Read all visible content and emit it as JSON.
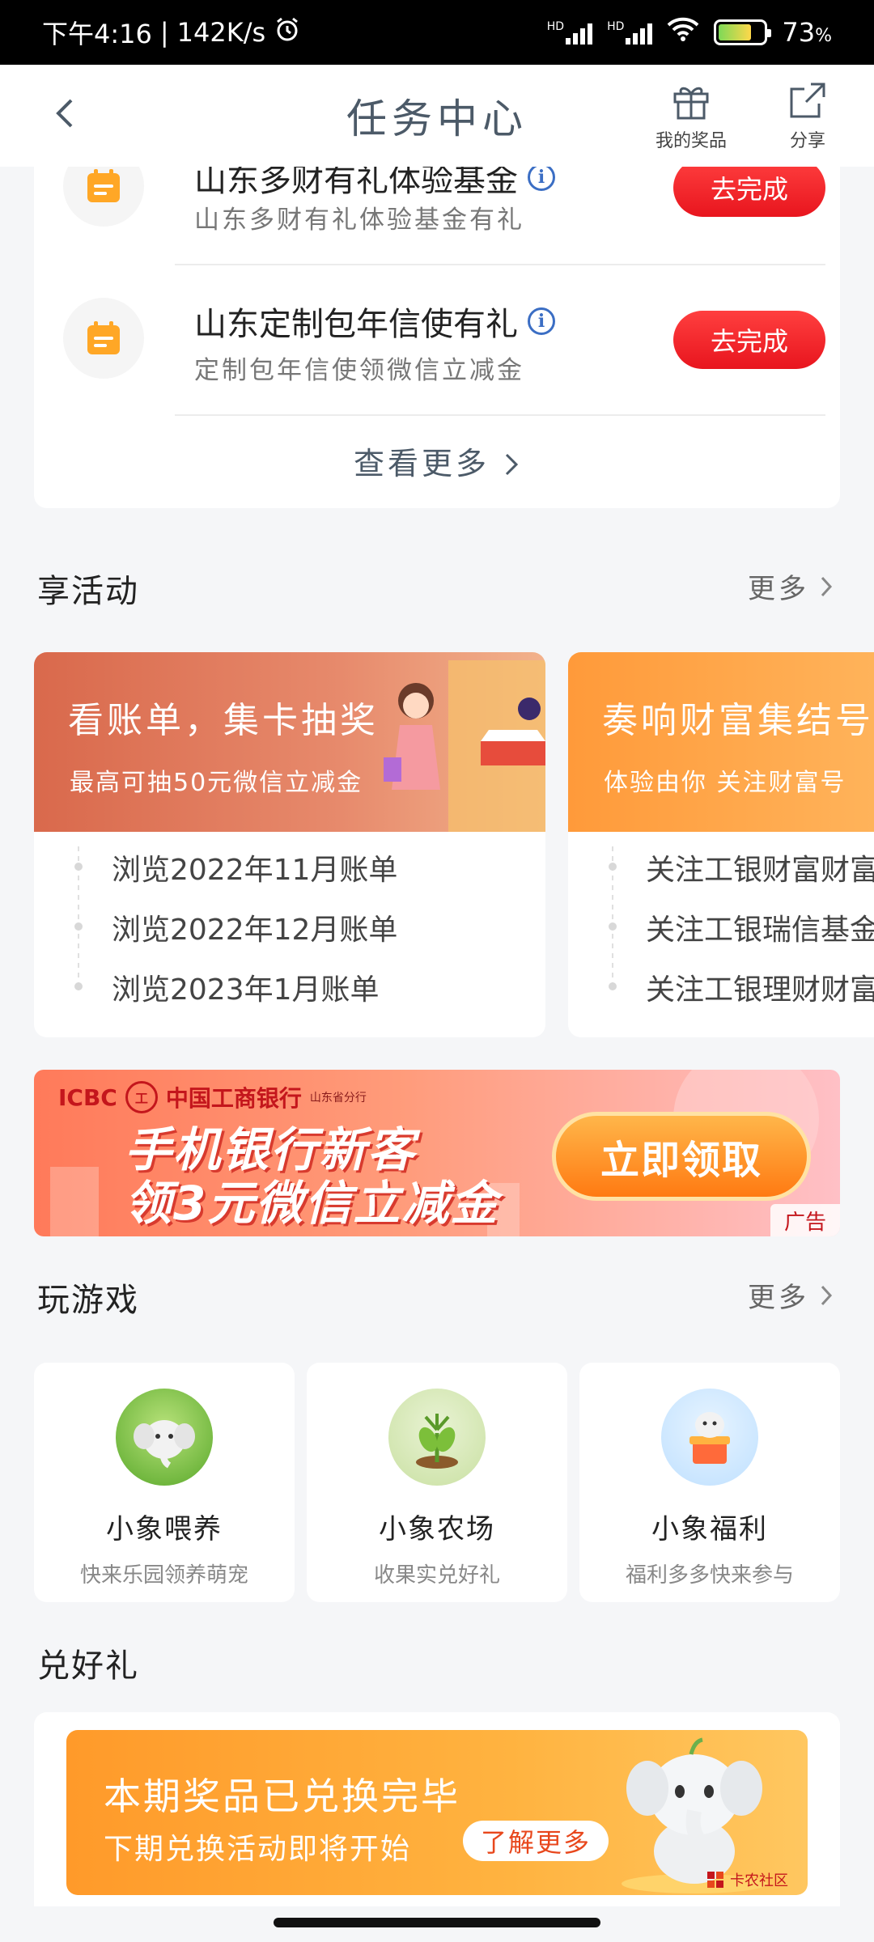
{
  "status_bar": {
    "time": "下午4:16",
    "separator": "|",
    "speed": "142K/s",
    "battery": "73",
    "battery_unit": "%",
    "battery_level": 0.73,
    "network_labels": [
      "HD",
      "HD"
    ]
  },
  "header": {
    "title": "任务中心",
    "my_prizes_label": "我的奖品",
    "share_label": "分享"
  },
  "tasks": {
    "items": [
      {
        "title": "山东多财有礼体验基金",
        "subtitle": "山东多财有礼体验基金有礼",
        "button": "去完成"
      },
      {
        "title": "山东定制包年信使有礼",
        "subtitle": "定制包年信使领微信立减金",
        "button": "去完成"
      }
    ],
    "info_glyph": "i",
    "see_more": "查看更多"
  },
  "activities": {
    "heading": "享活动",
    "more": "更多",
    "cards": [
      {
        "banner_title": "看账单，集卡抽奖",
        "banner_subtitle": "最高可抽50元微信立减金",
        "items": [
          "浏览2022年11月账单",
          "浏览2022年12月账单",
          "浏览2023年1月账单"
        ]
      },
      {
        "banner_title": "奏响财富集结号",
        "banner_subtitle": "体验由你 关注财富号",
        "items": [
          "关注工银财富财富",
          "关注工银瑞信基金",
          "关注工银理财财富"
        ]
      }
    ]
  },
  "ad": {
    "brand_en": "ICBC",
    "brand_mark": "工",
    "brand_cn": "中国工商银行",
    "branch": "山东省分行",
    "line1": "手机银行新客",
    "line2": "领3元微信立减金",
    "button": "立即领取",
    "tag": "广告"
  },
  "games": {
    "heading": "玩游戏",
    "more": "更多",
    "items": [
      {
        "name": "小象喂养",
        "desc": "快来乐园领养萌宠"
      },
      {
        "name": "小象农场",
        "desc": "收果实兑好礼"
      },
      {
        "name": "小象福利",
        "desc": "福利多多快来参与"
      }
    ]
  },
  "redeem": {
    "heading": "兑好礼",
    "title": "本期奖品已兑换完毕",
    "subtitle": "下期兑换活动即将开始",
    "button": "了解更多",
    "watermark": "卡农社区"
  },
  "colors": {
    "primary_red": "#e8151e",
    "title_gray": "#4c5a68",
    "orange": "#ff9a2a",
    "icon_orange": "#ffa726"
  }
}
